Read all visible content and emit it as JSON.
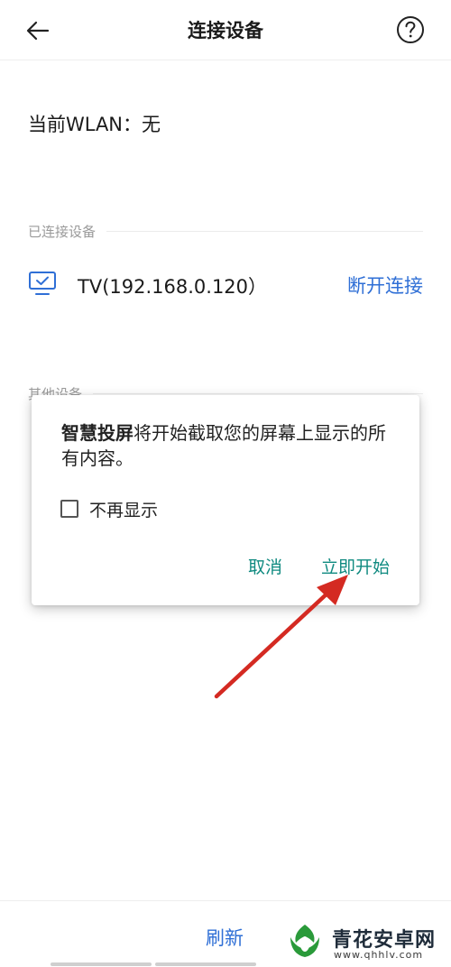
{
  "header": {
    "title": "连接设备",
    "back_icon": "arrow-left-icon",
    "help_icon": "question-circle-icon"
  },
  "wlan": {
    "text": "当前WLAN：无"
  },
  "sections": {
    "connected_label": "已连接设备",
    "other_label": "其他设备"
  },
  "connected_device": {
    "icon": "monitor-check-icon",
    "name": "TV(192.168.0.120）",
    "action": "断开连接"
  },
  "dialog": {
    "app_name": "智慧投屏",
    "message": "将开始截取您的屏幕上显示的所有内容。",
    "checkbox_label": "不再显示",
    "checkbox_checked": false,
    "cancel": "取消",
    "start": "立即开始"
  },
  "bottom": {
    "refresh": "刷新"
  },
  "watermark": {
    "title": "青花安卓网",
    "url": "www.qhhlv.com"
  },
  "colors": {
    "accent_blue": "#2f6fd6",
    "dialog_teal": "#0f8a80",
    "arrow_red": "#d42a22"
  }
}
